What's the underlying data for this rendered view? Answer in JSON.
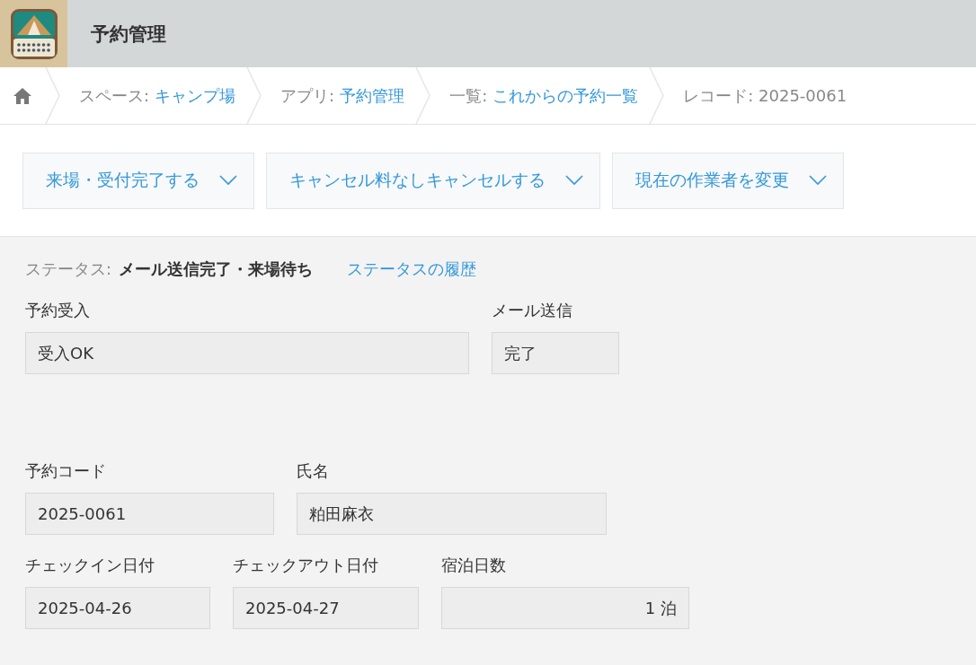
{
  "app": {
    "title": "予約管理"
  },
  "breadcrumb": [
    {
      "prefix": "スペース:",
      "link": "キャンプ場"
    },
    {
      "prefix": "アプリ:",
      "link": "予約管理"
    },
    {
      "prefix": "一覧:",
      "link": "これからの予約一覧"
    },
    {
      "prefix": "レコード: 2025-0061"
    }
  ],
  "actions": [
    "来場・受付完了する",
    "キャンセル料なしキャンセルする",
    "現在の作業者を変更"
  ],
  "status": {
    "label": "ステータス:",
    "value": "メール送信完了・来場待ち",
    "history_link": "ステータスの履歴"
  },
  "field_rows": [
    [
      {
        "label": "予約受入",
        "value": "受入OK",
        "kind": "text"
      },
      {
        "label": "メール送信",
        "value": "完了",
        "kind": "text"
      }
    ],
    [
      {
        "label": "予約コード",
        "value": "2025-0061",
        "kind": "text"
      },
      {
        "label": "氏名",
        "value": "粕田麻衣",
        "kind": "text"
      }
    ],
    [
      {
        "label": "チェックイン日付",
        "value": "2025-04-26",
        "kind": "text"
      },
      {
        "label": "チェックアウト日付",
        "value": "2025-04-27",
        "kind": "text"
      },
      {
        "label": "宿泊日数",
        "value": "1 泊",
        "kind": "number"
      }
    ]
  ]
}
